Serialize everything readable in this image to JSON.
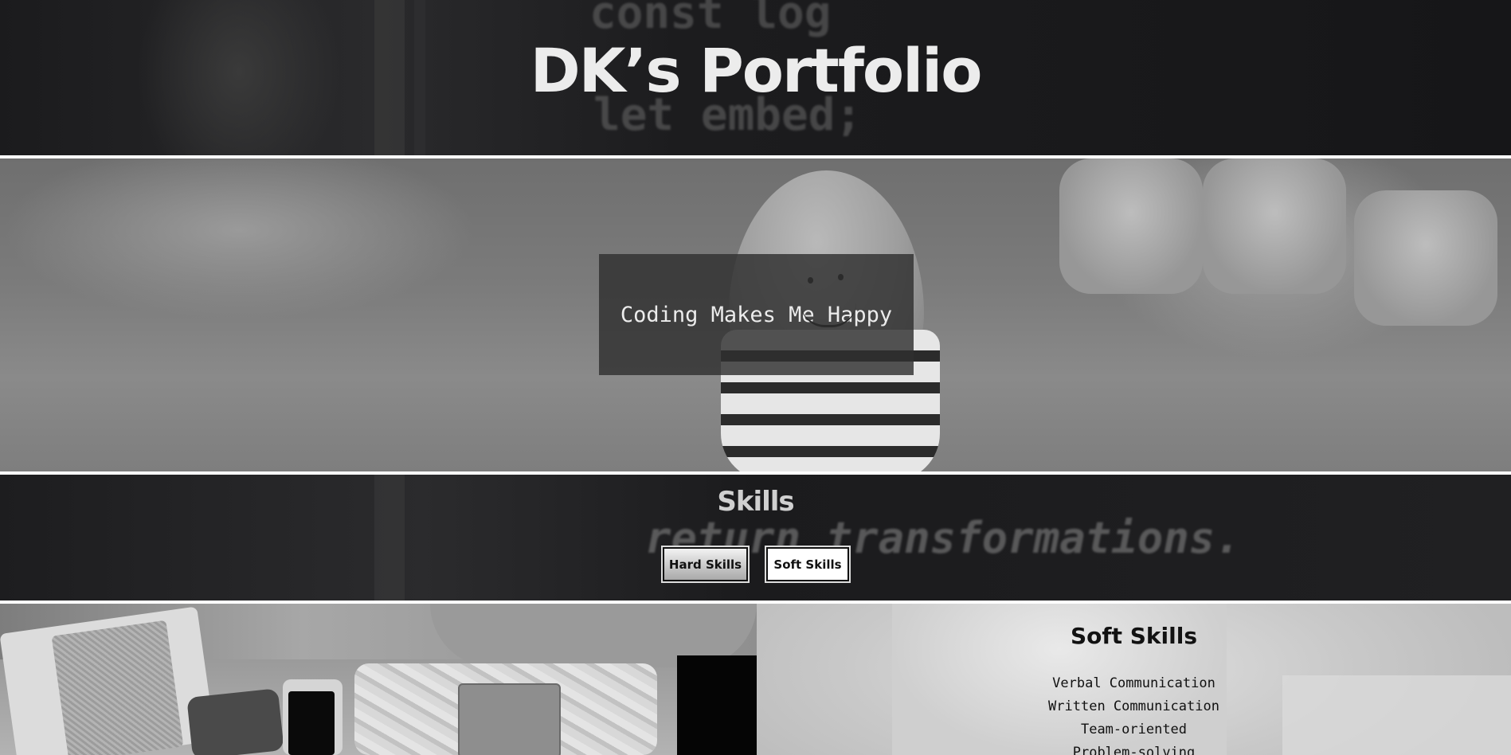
{
  "header": {
    "title": "DK’s Portfolio",
    "background_code": [
      "const log",
      "let embed;"
    ]
  },
  "hero": {
    "tagline": "Coding Makes Me Happy"
  },
  "skills": {
    "title": "Skills",
    "background_code": "return transformations.",
    "buttons": {
      "hard": "Hard Skills",
      "soft": "Soft Skills"
    }
  },
  "soft_skills": {
    "title": "Soft Skills",
    "items": [
      "Verbal Communication",
      "Written Communication",
      "Team-oriented",
      "Problem-solving"
    ]
  },
  "colors": {
    "title_text": "#ececec",
    "tagline_box": "#303030",
    "band_dark": "#1d1d1f"
  }
}
